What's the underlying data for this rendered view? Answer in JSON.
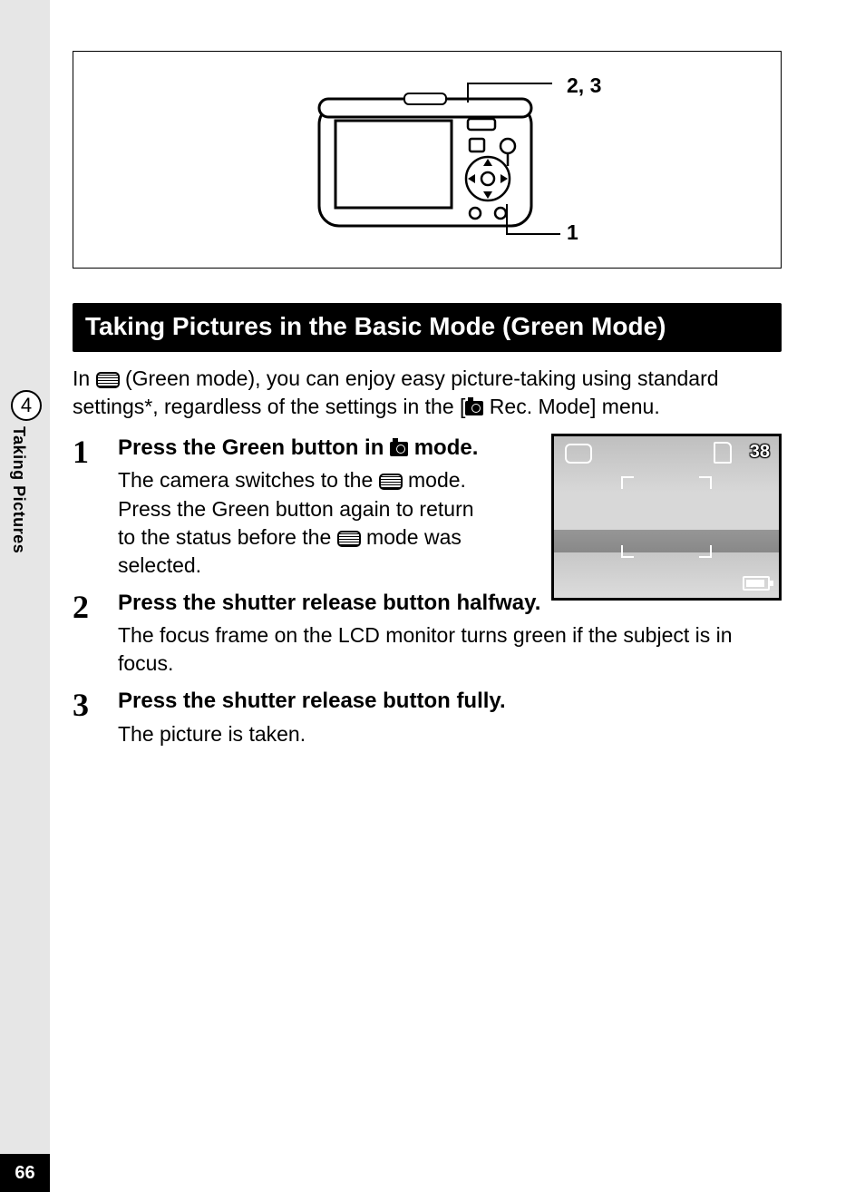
{
  "page_number": "66",
  "side_tab": {
    "number": "4",
    "label": "Taking Pictures"
  },
  "diagram": {
    "callout_top": "2, 3",
    "callout_bottom": "1"
  },
  "section_title": "Taking Pictures in the Basic Mode (Green Mode)",
  "intro": {
    "part1": "In ",
    "part2": " (Green mode), you can enjoy easy picture-taking using standard settings*, regardless of the settings in the [",
    "part3": " Rec. Mode] menu."
  },
  "lcd": {
    "count": "38"
  },
  "steps": [
    {
      "num": "1",
      "head_a": "Press the Green button in ",
      "head_b": " mode.",
      "desc_a": "The camera switches to the ",
      "desc_b": " mode. Press the Green button again to return to the status before the ",
      "desc_c": " mode was selected."
    },
    {
      "num": "2",
      "head": "Press the shutter release button halfway.",
      "desc": "The focus frame on the LCD monitor turns green if the subject is in focus."
    },
    {
      "num": "3",
      "head": "Press the shutter release button fully.",
      "desc": "The picture is taken."
    }
  ]
}
